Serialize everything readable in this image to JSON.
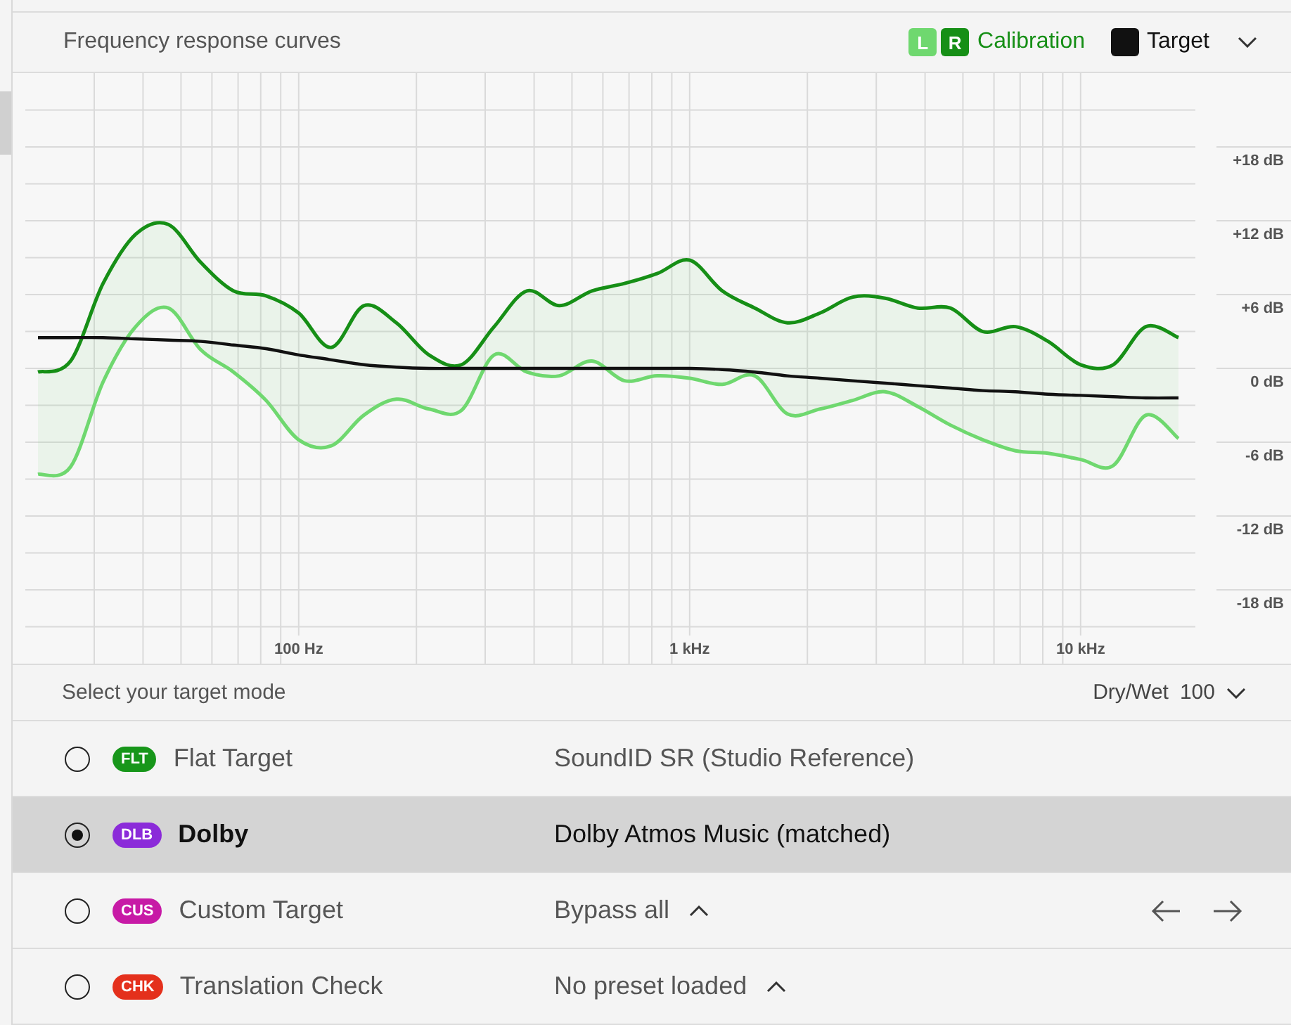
{
  "header": {
    "title": "Frequency response curves",
    "calibration_label": "Calibration"
  },
  "chart_data": {
    "type": "line",
    "categories": [
      null,
      null,
      null,
      null,
      null,
      null,
      null,
      null,
      "100 Hz",
      null,
      null,
      null,
      null,
      null,
      null,
      null,
      null,
      null,
      null,
      null,
      "1 kHz",
      null,
      null,
      null,
      null,
      null,
      null,
      null,
      null,
      null,
      null,
      null,
      "10 kHz",
      null,
      null,
      null
    ],
    "series": [
      {
        "name": "L",
        "color": "#6fd86f",
        "values": [
          -8.6,
          -8.0,
          -1.1,
          3.4,
          4.9,
          1.5,
          -0.3,
          -2.6,
          -5.8,
          -6.3,
          -3.8,
          -2.5,
          -3.3,
          -3.4,
          1.1,
          -0.3,
          -0.6,
          0.6,
          -1.0,
          -0.6,
          -0.8,
          -1.3,
          -0.6,
          -3.7,
          -3.3,
          -2.6,
          -1.9,
          -3.1,
          -4.6,
          -5.8,
          -6.7,
          -6.9,
          -7.4,
          -7.9,
          -3.8,
          -5.7
        ]
      },
      {
        "name": "R",
        "color": "#168f16",
        "values": [
          -0.3,
          0.6,
          6.9,
          10.9,
          11.7,
          8.6,
          6.3,
          5.9,
          4.5,
          1.7,
          5.1,
          3.7,
          1.1,
          0.3,
          3.4,
          6.3,
          5.1,
          6.3,
          6.9,
          7.7,
          8.8,
          6.3,
          4.9,
          3.7,
          4.5,
          5.8,
          5.7,
          4.9,
          4.9,
          3.0,
          3.4,
          2.2,
          0.3,
          0.3,
          3.4,
          2.5
        ]
      },
      {
        "name": "Target",
        "color": "#111111",
        "values": [
          2.5,
          2.5,
          2.5,
          2.4,
          2.3,
          2.2,
          1.9,
          1.6,
          1.1,
          0.7,
          0.3,
          0.1,
          0.0,
          0.0,
          0.0,
          0.0,
          0.0,
          0.0,
          0.0,
          0.0,
          0.0,
          -0.1,
          -0.3,
          -0.6,
          -0.8,
          -1.0,
          -1.2,
          -1.4,
          -1.6,
          -1.8,
          -1.9,
          -2.1,
          -2.2,
          -2.3,
          -2.4,
          -2.4
        ]
      }
    ],
    "ylim": [
      -24,
      24
    ],
    "grid": true,
    "yticks": [
      {
        "value": 18,
        "label": "+18 dB"
      },
      {
        "value": 12,
        "label": "+12 dB"
      },
      {
        "value": 6,
        "label": "+6 dB"
      },
      {
        "value": 0,
        "label": "0 dB"
      },
      {
        "value": -6,
        "label": "-6 dB"
      },
      {
        "value": -12,
        "label": "-12 dB"
      },
      {
        "value": -18,
        "label": "-18 dB"
      }
    ]
  },
  "mode_bar": {
    "prompt": "Select your target mode",
    "dry_wet_label": "Dry/Wet",
    "dry_wet_value": "100"
  },
  "modes": [
    {
      "code": "FLT",
      "color": "#17961a",
      "name": "Flat Target",
      "preset": "SoundID SR (Studio Reference)",
      "selected": false,
      "preset_menu": false,
      "navigation": false
    },
    {
      "code": "DLB",
      "color": "#8b2bd9",
      "name": "Dolby",
      "preset": "Dolby Atmos Music (matched)",
      "selected": true,
      "preset_menu": false,
      "navigation": false
    },
    {
      "code": "CUS",
      "color": "#c71aa6",
      "name": "Custom Target",
      "preset": "Bypass all",
      "selected": false,
      "preset_menu": true,
      "navigation": true
    },
    {
      "code": "CHK",
      "color": "#e4301c",
      "name": "Translation Check",
      "preset": "No preset loaded",
      "selected": false,
      "preset_menu": true,
      "navigation": false
    }
  ]
}
